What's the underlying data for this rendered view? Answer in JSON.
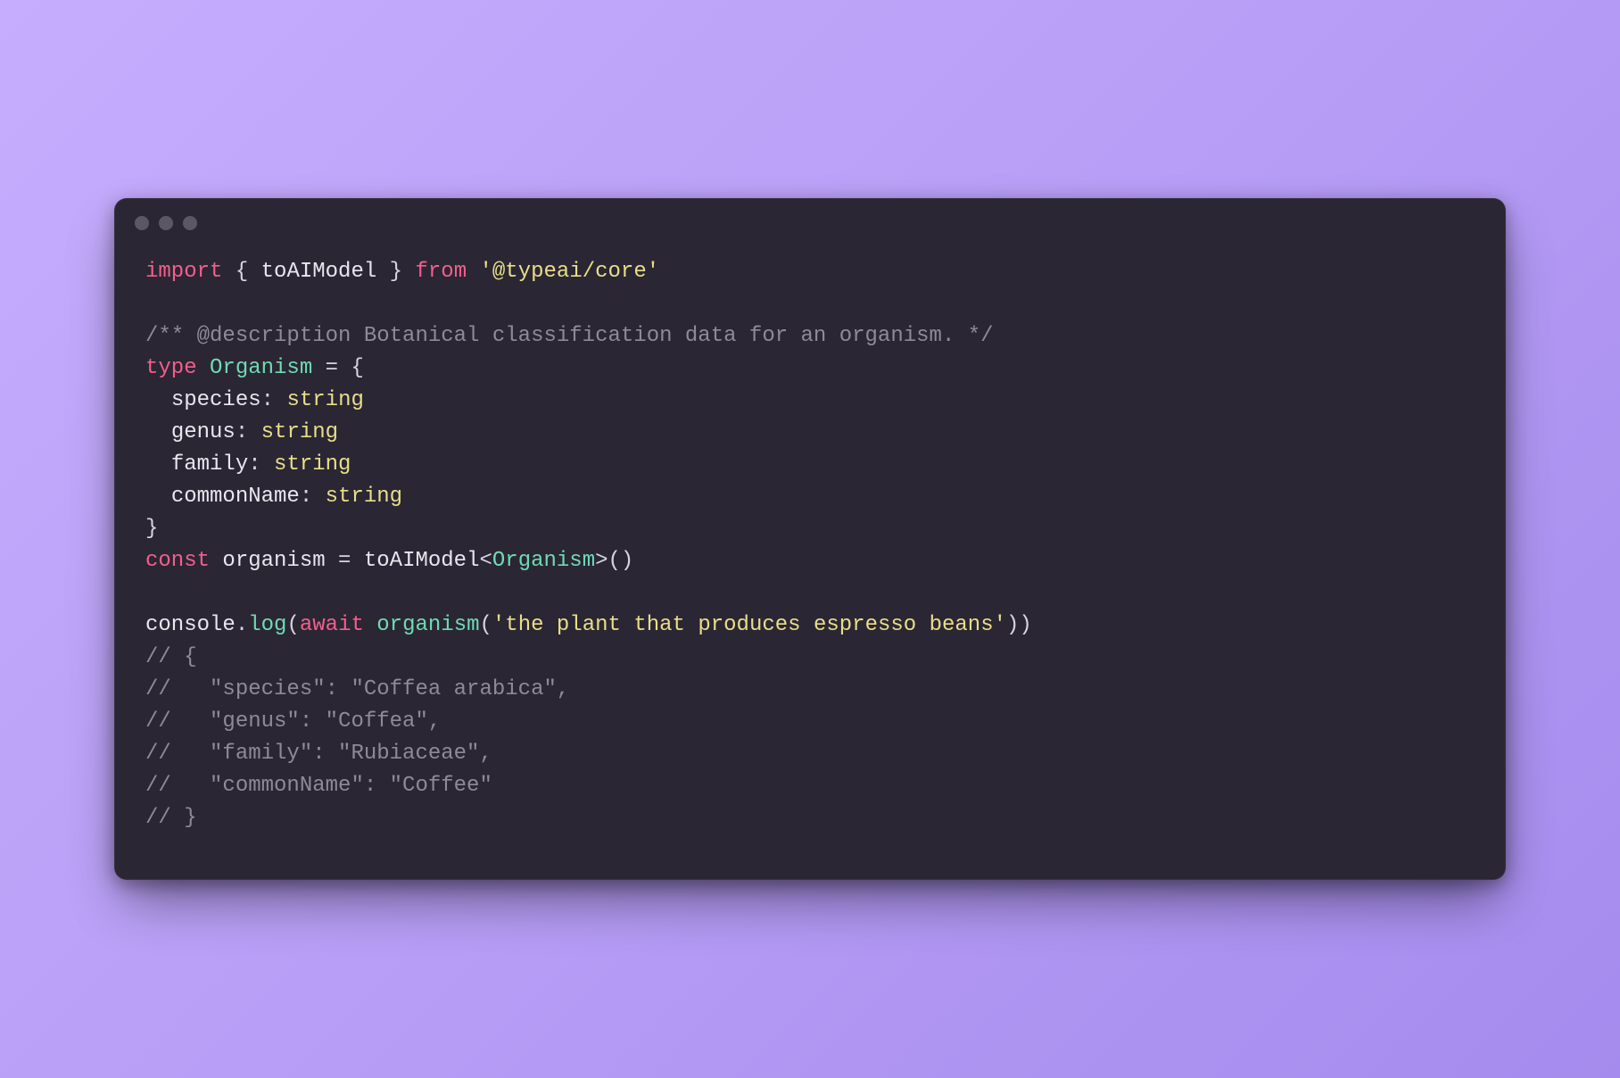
{
  "colors": {
    "bgGradientStart": "#c7adfd",
    "bgGradientEnd": "#a58bed",
    "windowBg": "#2b2634",
    "dot": "#5c5764",
    "keyword": "#f25f8c",
    "string": "#e9de89",
    "type": "#6edbb3",
    "comment": "#8e8a97",
    "default": "#e8e6ee"
  },
  "code": {
    "lines": [
      [
        {
          "t": "keyword",
          "v": "import"
        },
        {
          "t": "punct",
          "v": " { "
        },
        {
          "t": "ident",
          "v": "toAIModel"
        },
        {
          "t": "punct",
          "v": " } "
        },
        {
          "t": "keyword",
          "v": "from"
        },
        {
          "t": "punct",
          "v": " "
        },
        {
          "t": "string",
          "v": "'@typeai/core'"
        }
      ],
      [],
      [
        {
          "t": "comment",
          "v": "/** @description Botanical classification data for an organism. */"
        }
      ],
      [
        {
          "t": "keyword",
          "v": "type"
        },
        {
          "t": "punct",
          "v": " "
        },
        {
          "t": "type",
          "v": "Organism"
        },
        {
          "t": "punct",
          "v": " = {"
        }
      ],
      [
        {
          "t": "punct",
          "v": "  "
        },
        {
          "t": "ident",
          "v": "species"
        },
        {
          "t": "punct",
          "v": ": "
        },
        {
          "t": "string",
          "v": "string"
        }
      ],
      [
        {
          "t": "punct",
          "v": "  "
        },
        {
          "t": "ident",
          "v": "genus"
        },
        {
          "t": "punct",
          "v": ": "
        },
        {
          "t": "string",
          "v": "string"
        }
      ],
      [
        {
          "t": "punct",
          "v": "  "
        },
        {
          "t": "ident",
          "v": "family"
        },
        {
          "t": "punct",
          "v": ": "
        },
        {
          "t": "string",
          "v": "string"
        }
      ],
      [
        {
          "t": "punct",
          "v": "  "
        },
        {
          "t": "ident",
          "v": "commonName"
        },
        {
          "t": "punct",
          "v": ": "
        },
        {
          "t": "string",
          "v": "string"
        }
      ],
      [
        {
          "t": "punct",
          "v": "}"
        }
      ],
      [
        {
          "t": "keyword",
          "v": "const"
        },
        {
          "t": "punct",
          "v": " "
        },
        {
          "t": "ident",
          "v": "organism"
        },
        {
          "t": "punct",
          "v": " = "
        },
        {
          "t": "ident",
          "v": "toAIModel"
        },
        {
          "t": "punct",
          "v": "<"
        },
        {
          "t": "type",
          "v": "Organism"
        },
        {
          "t": "punct",
          "v": ">()"
        }
      ],
      [],
      [
        {
          "t": "ident",
          "v": "console"
        },
        {
          "t": "punct",
          "v": "."
        },
        {
          "t": "member",
          "v": "log"
        },
        {
          "t": "punct",
          "v": "("
        },
        {
          "t": "keyword",
          "v": "await"
        },
        {
          "t": "punct",
          "v": " "
        },
        {
          "t": "type",
          "v": "organism"
        },
        {
          "t": "punct",
          "v": "("
        },
        {
          "t": "string",
          "v": "'the plant that produces espresso beans'"
        },
        {
          "t": "punct",
          "v": "))"
        }
      ],
      [
        {
          "t": "comment",
          "v": "// {"
        }
      ],
      [
        {
          "t": "comment",
          "v": "//   \"species\": \"Coffea arabica\","
        }
      ],
      [
        {
          "t": "comment",
          "v": "//   \"genus\": \"Coffea\","
        }
      ],
      [
        {
          "t": "comment",
          "v": "//   \"family\": \"Rubiaceae\","
        }
      ],
      [
        {
          "t": "comment",
          "v": "//   \"commonName\": \"Coffee\""
        }
      ],
      [
        {
          "t": "comment",
          "v": "// }"
        }
      ]
    ]
  }
}
